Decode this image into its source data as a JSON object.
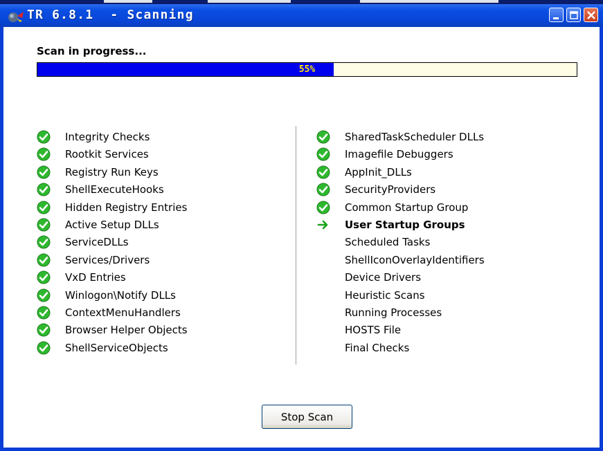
{
  "window": {
    "title": "TR 6.8.1  - Scanning"
  },
  "scan": {
    "status": "Scan in progress...",
    "progress_label": "55%",
    "progress": 0.55
  },
  "checks_left": [
    {
      "label": "Integrity Checks",
      "state": "done"
    },
    {
      "label": "Rootkit Services",
      "state": "done"
    },
    {
      "label": "Registry Run Keys",
      "state": "done"
    },
    {
      "label": "ShellExecuteHooks",
      "state": "done"
    },
    {
      "label": "Hidden Registry Entries",
      "state": "done"
    },
    {
      "label": "Active Setup DLLs",
      "state": "done"
    },
    {
      "label": "ServiceDLLs",
      "state": "done"
    },
    {
      "label": "Services/Drivers",
      "state": "done"
    },
    {
      "label": "VxD Entries",
      "state": "done"
    },
    {
      "label": "Winlogon\\Notify DLLs",
      "state": "done"
    },
    {
      "label": "ContextMenuHandlers",
      "state": "done"
    },
    {
      "label": "Browser Helper Objects",
      "state": "done"
    },
    {
      "label": "ShellServiceObjects",
      "state": "done"
    }
  ],
  "checks_right": [
    {
      "label": "SharedTaskScheduler DLLs",
      "state": "done"
    },
    {
      "label": "Imagefile Debuggers",
      "state": "done"
    },
    {
      "label": "AppInit_DLLs",
      "state": "done"
    },
    {
      "label": "SecurityProviders",
      "state": "done"
    },
    {
      "label": "Common Startup Group",
      "state": "done"
    },
    {
      "label": "User Startup Groups",
      "state": "current"
    },
    {
      "label": "Scheduled Tasks",
      "state": "pending"
    },
    {
      "label": "ShellIconOverlayIdentifiers",
      "state": "pending"
    },
    {
      "label": "Device Drivers",
      "state": "pending"
    },
    {
      "label": "Heuristic Scans",
      "state": "pending"
    },
    {
      "label": "Running Processes",
      "state": "pending"
    },
    {
      "label": "HOSTS File",
      "state": "pending"
    },
    {
      "label": "Final Checks",
      "state": "pending"
    }
  ],
  "buttons": {
    "stop_scan": "Stop Scan"
  },
  "icons": {
    "done": "check-circle-icon",
    "current": "arrow-right-icon"
  },
  "colors": {
    "progress_fill": "#0000ee",
    "progress_text": "#ffe600",
    "check_green": "#2eb82e",
    "arrow_green": "#1aa31a"
  }
}
